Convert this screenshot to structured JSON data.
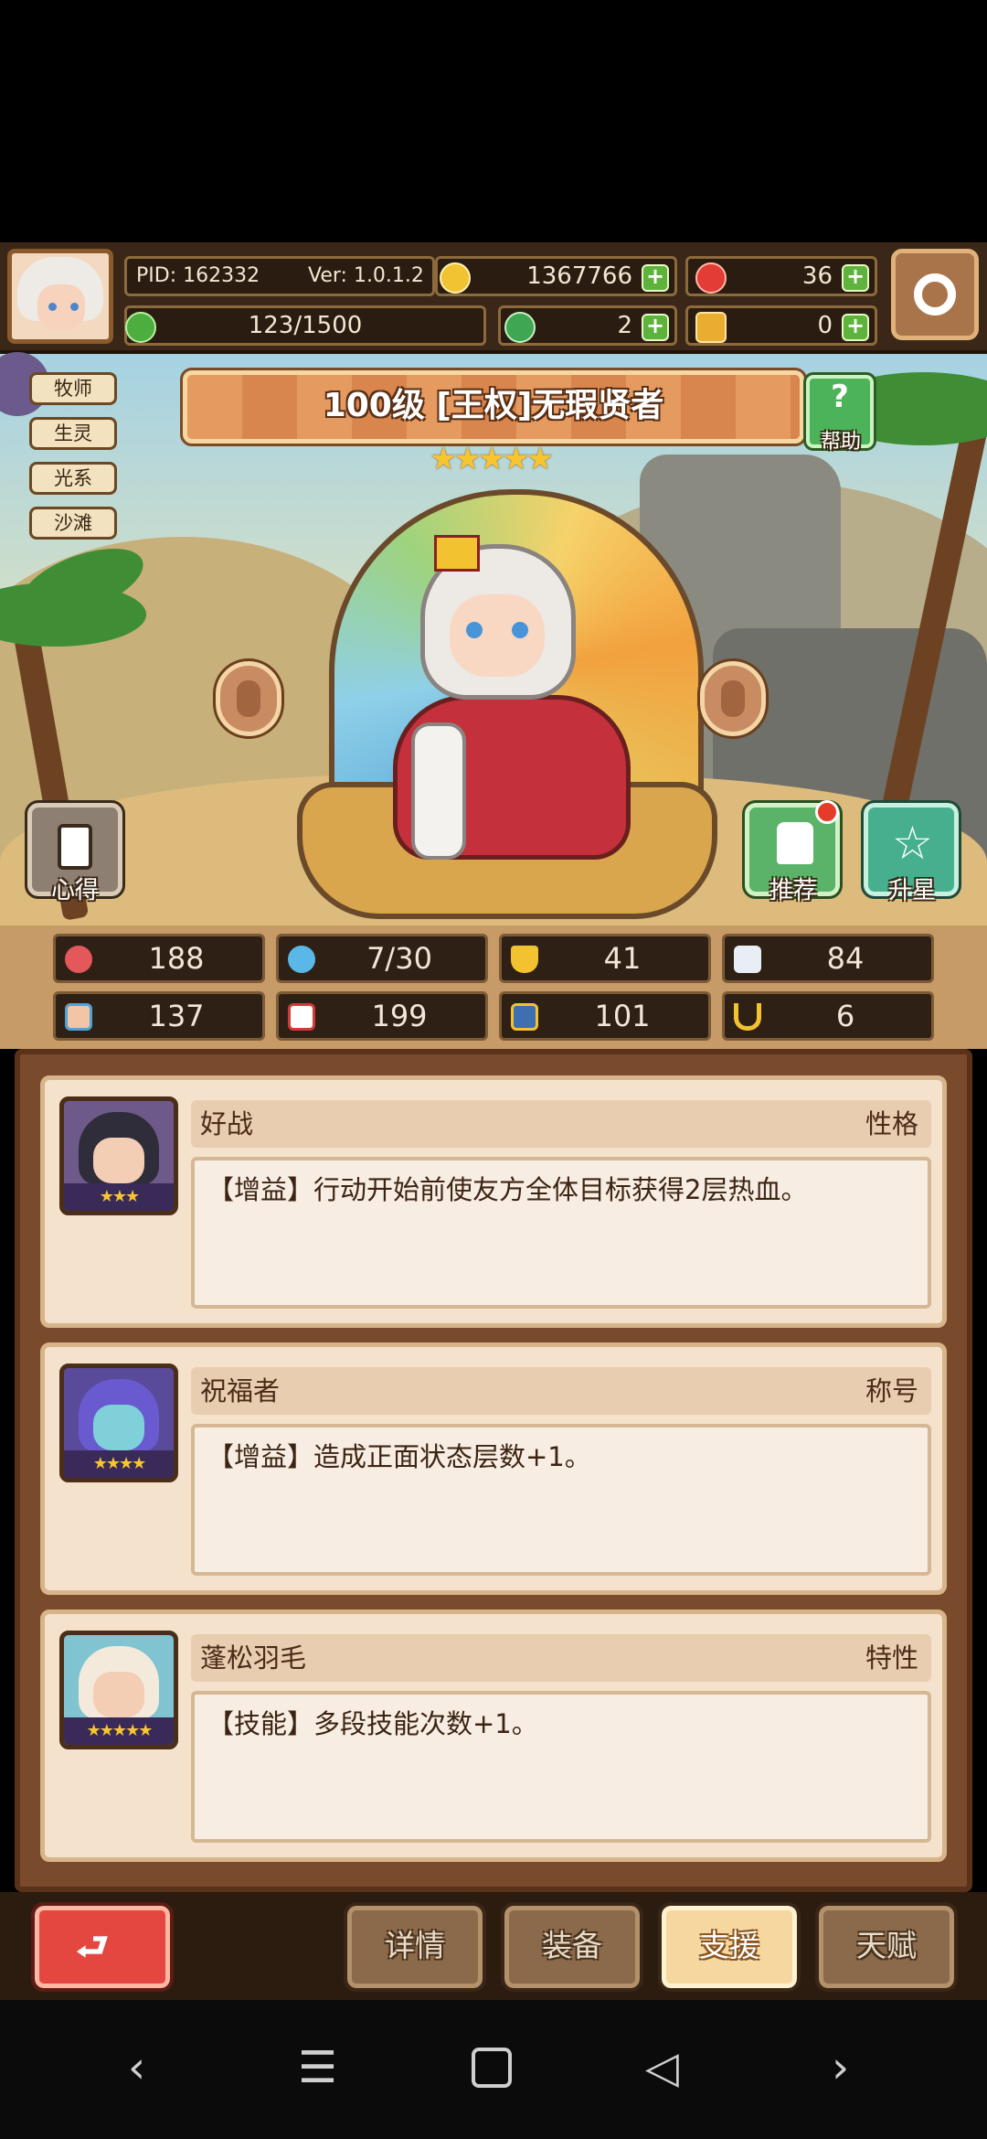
{
  "top_bar": {
    "pid": "PID: 162332",
    "version": "Ver: 1.0.1.2",
    "gold": "1367766",
    "gems": "36",
    "energy": "123/1500",
    "clover": "2",
    "key": "0"
  },
  "side_tags": [
    "牧师",
    "生灵",
    "光系",
    "沙滩"
  ],
  "hero": {
    "title": "100级 [王权]无瑕贤者",
    "stars": "★★★★★",
    "help_label": "帮助"
  },
  "scene_buttons": {
    "insight_label": "心得",
    "recommend_label": "推荐",
    "star_up_label": "升星"
  },
  "stats": [
    "188",
    "7/30",
    "41",
    "84",
    "137",
    "199",
    "101",
    "6"
  ],
  "traits": [
    {
      "name": "好战",
      "type": "性格",
      "desc": "【增益】行动开始前使友方全体目标获得2层热血。",
      "stars": "★★★"
    },
    {
      "name": "祝福者",
      "type": "称号",
      "desc": "【增益】造成正面状态层数+1。",
      "stars": "★★★★"
    },
    {
      "name": "蓬松羽毛",
      "type": "特性",
      "desc": "【技能】多段技能次数+1。",
      "stars": "★★★★★"
    }
  ],
  "bottom_tabs": {
    "details": "详情",
    "equipment": "装备",
    "support": "支援",
    "talent": "天赋"
  },
  "colors": {
    "accent_red": "#e4473f",
    "active_tab": "#f6d7a0",
    "panel_brown": "#7a4a2c",
    "star_gold": "#f7c530"
  }
}
